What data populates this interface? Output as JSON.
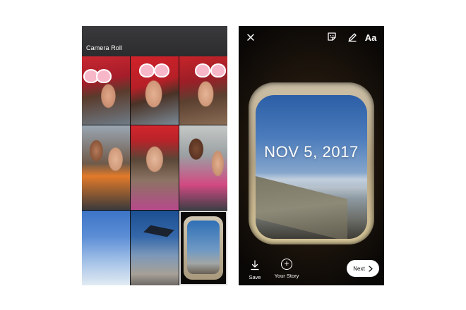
{
  "camera_roll": {
    "title": "Camera Roll"
  },
  "story_editor": {
    "date_sticker": "NOV 5, 2017",
    "toolbar": {
      "close_icon": "close-icon",
      "sticker_icon": "sticker-icon",
      "draw_icon": "pen-icon",
      "text_label": "Aa"
    },
    "bottom": {
      "save_label": "Save",
      "your_story_label": "Your Story",
      "next_label": "Next"
    }
  }
}
